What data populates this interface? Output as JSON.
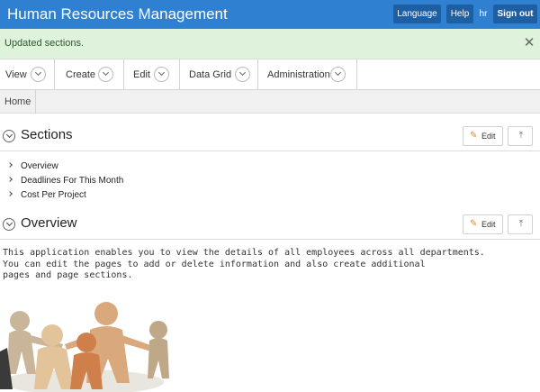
{
  "header": {
    "app_title": "Human Resources Management",
    "language_label": "Language",
    "help_label": "Help",
    "user": "hr",
    "signout_label": "Sign out"
  },
  "message": {
    "text": "Updated sections.",
    "close_glyph": "✕"
  },
  "menu": {
    "items": [
      {
        "label": "View"
      },
      {
        "label": "Create"
      },
      {
        "label": "Edit"
      },
      {
        "label": "Data Grid"
      },
      {
        "label": "Administration"
      }
    ]
  },
  "breadcrumb": {
    "items": [
      {
        "label": "Home"
      }
    ]
  },
  "sections_region": {
    "title": "Sections",
    "edit_label": "Edit",
    "items": [
      {
        "label": "Overview"
      },
      {
        "label": "Deadlines For This Month"
      },
      {
        "label": "Cost Per Project"
      }
    ]
  },
  "overview_region": {
    "title": "Overview",
    "edit_label": "Edit",
    "text": "This application enables you to view the details of all employees across all departments.\nYou can edit the pages to add or delete information and also create additional\npages and page sections."
  },
  "icons": {
    "edit": "pencil-icon",
    "top": "arrow-to-top-icon",
    "toggle": "chevron-down-circle-icon",
    "menu": "chevron-down-circle-icon",
    "illustration": "paper-people-circle-image"
  },
  "colors": {
    "header_bg": "#2f80d1",
    "header_button": "#1e5fa3",
    "success_bg": "#dff2dc"
  }
}
